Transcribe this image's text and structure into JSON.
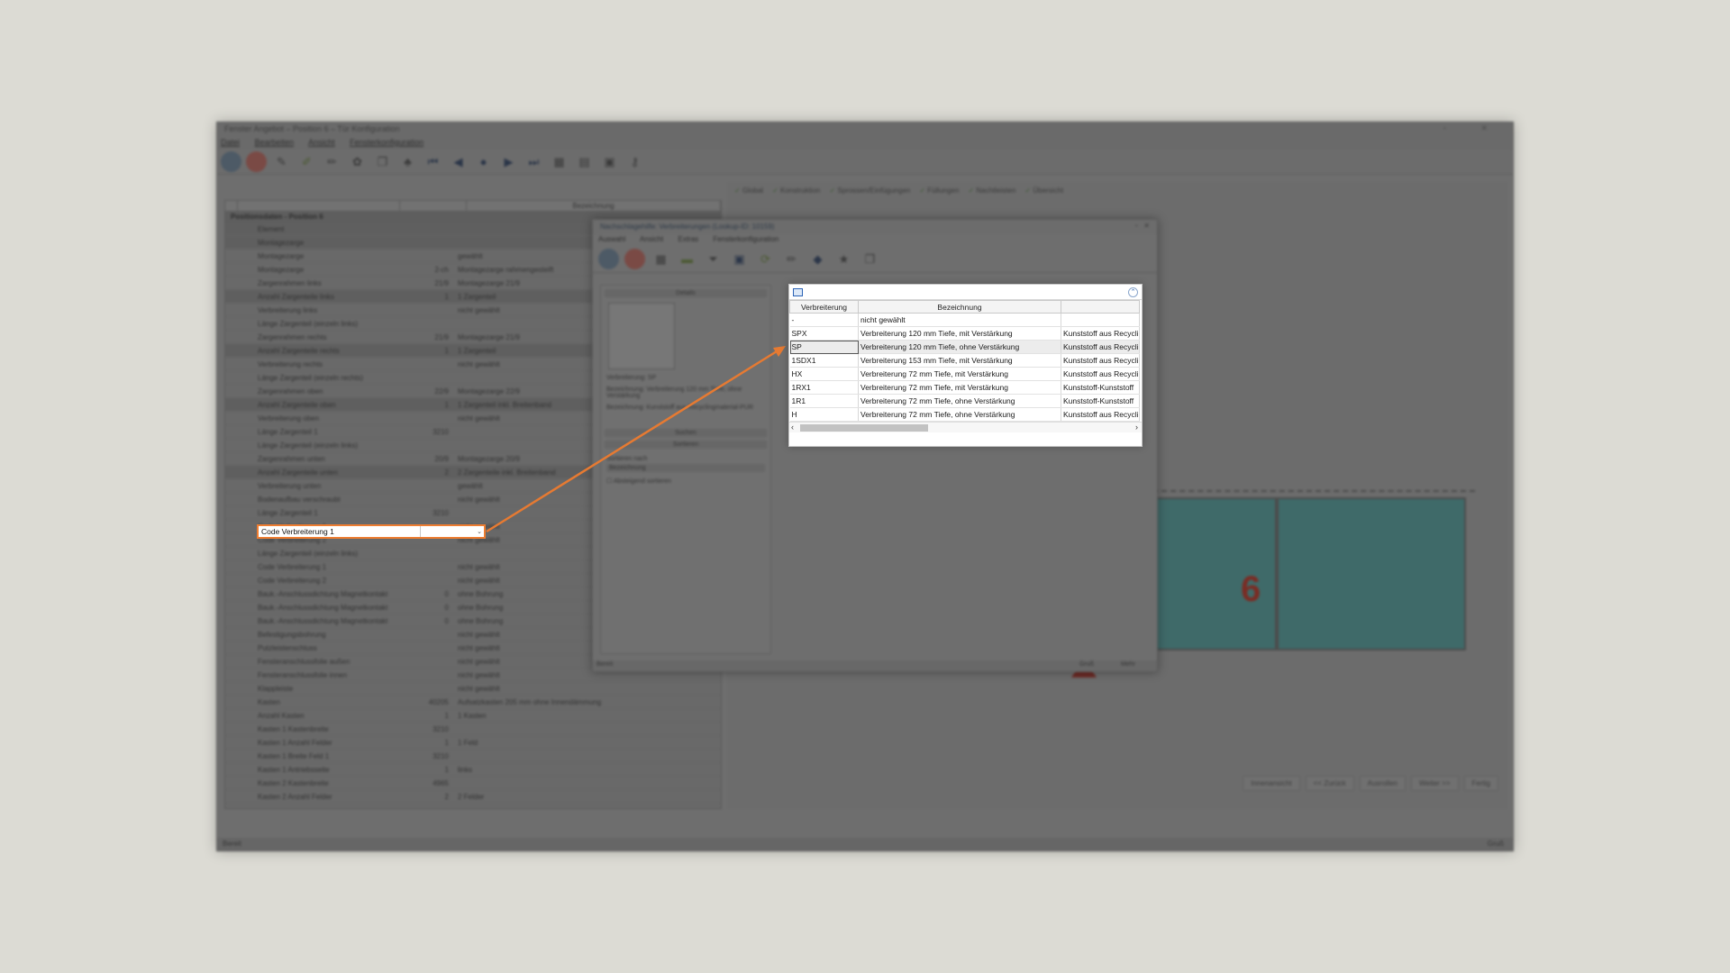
{
  "app": {
    "title": "Fenster Angebot – Position 6 – Tür Konfiguration",
    "menu": [
      "Datei",
      "Bearbeiten",
      "Ansicht",
      "Fensterkonfiguration"
    ],
    "tabs": [
      "Global",
      "Konstruktion",
      "Sprossen/Einfügungen",
      "Füllungen",
      "Nachtleisten",
      "Übersicht"
    ],
    "left_title": "Positionsdaten - Position 6",
    "column_header": "Bezeichnung",
    "status_left": "Bereit",
    "status_right": "Gruß",
    "buttons": [
      "Innenansicht",
      "<< Zurück",
      "Ausrollen",
      "Weiter >>",
      "Fertig"
    ],
    "preview_label": "6",
    "properties": [
      {
        "name": "Element",
        "value": "",
        "desc": "",
        "group": true
      },
      {
        "name": "Montagezarge",
        "value": "",
        "desc": "",
        "group": true
      },
      {
        "name": "Montagezarge",
        "value": "",
        "desc": "gewählt",
        "group": false
      },
      {
        "name": "Montagezarge",
        "value": "2-ch",
        "desc": "Montagezarge rahmengesteift",
        "group": false
      },
      {
        "name": "Zargenrahmen links",
        "value": "21/9",
        "desc": "Montagezarge 21/9",
        "group": false
      },
      {
        "name": "Anzahl Zargenteile links",
        "value": "1",
        "desc": "1 Zargenteil",
        "group": true
      },
      {
        "name": "Verbreiterung links",
        "value": "",
        "desc": "nicht gewählt",
        "group": false
      },
      {
        "name": "Länge Zargenteil (einzeln links)",
        "value": "",
        "desc": "",
        "group": false
      },
      {
        "name": "Zargenrahmen rechts",
        "value": "21/9",
        "desc": "Montagezarge 21/9",
        "group": false
      },
      {
        "name": "Anzahl Zargenteile rechts",
        "value": "1",
        "desc": "1 Zargenteil",
        "group": true
      },
      {
        "name": "Verbreiterung rechts",
        "value": "",
        "desc": "nicht gewählt",
        "group": false
      },
      {
        "name": "Länge Zargenteil (einzeln rechts)",
        "value": "",
        "desc": "",
        "group": false
      },
      {
        "name": "Zargenrahmen oben",
        "value": "22/9",
        "desc": "Montagezarge 22/9",
        "group": false
      },
      {
        "name": "Anzahl Zargenteile oben",
        "value": "1",
        "desc": "1 Zargenteil inkl. Breitenband",
        "group": true
      },
      {
        "name": "Verbreiterung oben",
        "value": "",
        "desc": "nicht gewählt",
        "group": false
      },
      {
        "name": "Länge Zargenteil 1",
        "value": "3210",
        "desc": "",
        "group": false
      },
      {
        "name": "Länge Zargenteil (einzeln links)",
        "value": "",
        "desc": "",
        "group": false
      },
      {
        "name": "Zargenrahmen unten",
        "value": "20/9",
        "desc": "Montagezarge 20/9",
        "group": false
      },
      {
        "name": "Anzahl Zargenteile unten",
        "value": "2",
        "desc": "2 Zargenteile inkl. Breitenband",
        "group": true
      },
      {
        "name": "Verbreiterung unten",
        "value": "",
        "desc": "gewählt",
        "group": false
      },
      {
        "name": "Bodenaufbau verschraubt",
        "value": "",
        "desc": "nicht gewählt",
        "group": false
      },
      {
        "name": "Länge Zargenteil 1",
        "value": "3210",
        "desc": "",
        "group": false
      },
      {
        "name": "Code Verbreiterung 1",
        "value": "",
        "desc": "nicht gewählt",
        "group": false
      },
      {
        "name": "Code Verbreiterung 2",
        "value": "",
        "desc": "nicht gewählt",
        "group": false
      },
      {
        "name": "Länge Zargenteil (einzeln links)",
        "value": "",
        "desc": "",
        "group": false
      },
      {
        "name": "Code Verbreiterung 1",
        "value": "",
        "desc": "nicht gewählt",
        "group": false
      },
      {
        "name": "Code Verbreiterung 2",
        "value": "",
        "desc": "nicht gewählt",
        "group": false
      },
      {
        "name": "Bauk.-Anschlussdichtung Magnetkontakt",
        "value": "0",
        "desc": "ohne Bohrung",
        "group": false
      },
      {
        "name": "Bauk.-Anschlussdichtung Magnetkontakt",
        "value": "0",
        "desc": "ohne Bohrung",
        "group": false
      },
      {
        "name": "Bauk.-Anschlussdichtung Magnetkontakt",
        "value": "0",
        "desc": "ohne Bohrung",
        "group": false
      },
      {
        "name": "Befestigungsbohrung",
        "value": "",
        "desc": "nicht gewählt",
        "group": false
      },
      {
        "name": "Putzleistenschluss",
        "value": "",
        "desc": "nicht gewählt",
        "group": false
      },
      {
        "name": "Fensteranschlussfolie außen",
        "value": "",
        "desc": "nicht gewählt",
        "group": false
      },
      {
        "name": "Fensteranschlussfolie innen",
        "value": "",
        "desc": "nicht gewählt",
        "group": false
      },
      {
        "name": "Klappleiste",
        "value": "",
        "desc": "nicht gewählt",
        "group": false
      },
      {
        "name": "Kasten",
        "value": "40205",
        "desc": "Aufsatzkasten 205 mm ohne Innendämmung",
        "group": false
      },
      {
        "name": "Anzahl Kasten",
        "value": "1",
        "desc": "1 Kasten",
        "group": false
      },
      {
        "name": "Kasten 1 Kastenbreite",
        "value": "3210",
        "desc": "",
        "group": false
      },
      {
        "name": "Kasten 1 Anzahl Felder",
        "value": "1",
        "desc": "1 Feld",
        "group": false
      },
      {
        "name": "Kasten 1 Breite Feld 1",
        "value": "3210",
        "desc": "",
        "group": false
      },
      {
        "name": "Kasten 1 Antriebsseite",
        "value": "1",
        "desc": "links",
        "group": false
      },
      {
        "name": "Kasten 2 Kastenbreite",
        "value": "4965",
        "desc": "",
        "group": false
      },
      {
        "name": "Kasten 2 Anzahl Felder",
        "value": "2",
        "desc": "2 Felder",
        "group": false
      }
    ]
  },
  "highlighted_field": {
    "label": "Code Verbreiterung 1",
    "value": ""
  },
  "dialog": {
    "title": "Nachschlagehilfe: Verbreiterungen (Lookup-ID: 10159)",
    "menu": [
      "Auswahl",
      "Ansicht",
      "Extras",
      "Fensterkonfiguration"
    ],
    "side_header": "Details",
    "side_lines": [
      "Verbreiterung: SP",
      "Bezeichnung: Verbreiterung 120 mm Tiefe, ohne Verstärkung",
      "Bezeichnung: Kunststoff aus Recyclingmaterial-PUR"
    ],
    "search_label": "Suchen",
    "sort_header": "Sortieren",
    "sort_by": "Sortieren nach",
    "sort_field": "Bezeichnung",
    "sort_desc": "Absteigend sortieren",
    "status_left": "Bereit",
    "status_mid": "Gruß",
    "status_right": "Mehr"
  },
  "lookup": {
    "columns": [
      "Verbreiterung",
      "Bezeichnung",
      ""
    ],
    "rows": [
      {
        "code": "-",
        "desc": "nicht gewählt",
        "material": ""
      },
      {
        "code": "SPX",
        "desc": "Verbreiterung 120 mm Tiefe, mit Verstärkung",
        "material": "Kunststoff aus Recyclin"
      },
      {
        "code": "SP",
        "desc": "Verbreiterung 120 mm Tiefe, ohne Verstärkung",
        "material": "Kunststoff aus Recyclin"
      },
      {
        "code": "1SDX1",
        "desc": "Verbreiterung 153 mm Tiefe, mit Verstärkung",
        "material": "Kunststoff aus Recyclin"
      },
      {
        "code": "HX",
        "desc": "Verbreiterung 72 mm Tiefe, mit Verstärkung",
        "material": "Kunststoff aus Recyclin"
      },
      {
        "code": "1RX1",
        "desc": "Verbreiterung 72 mm Tiefe, mit Verstärkung",
        "material": "Kunststoff-Kunststoff"
      },
      {
        "code": "1R1",
        "desc": "Verbreiterung 72 mm Tiefe, ohne Verstärkung",
        "material": "Kunststoff-Kunststoff"
      },
      {
        "code": "H",
        "desc": "Verbreiterung 72 mm Tiefe, ohne Verstärkung",
        "material": "Kunststoff aus Recyclin"
      }
    ],
    "selected_index": 2
  },
  "colors": {
    "accent": "#ee7d31",
    "glass": "#3f6a69"
  }
}
